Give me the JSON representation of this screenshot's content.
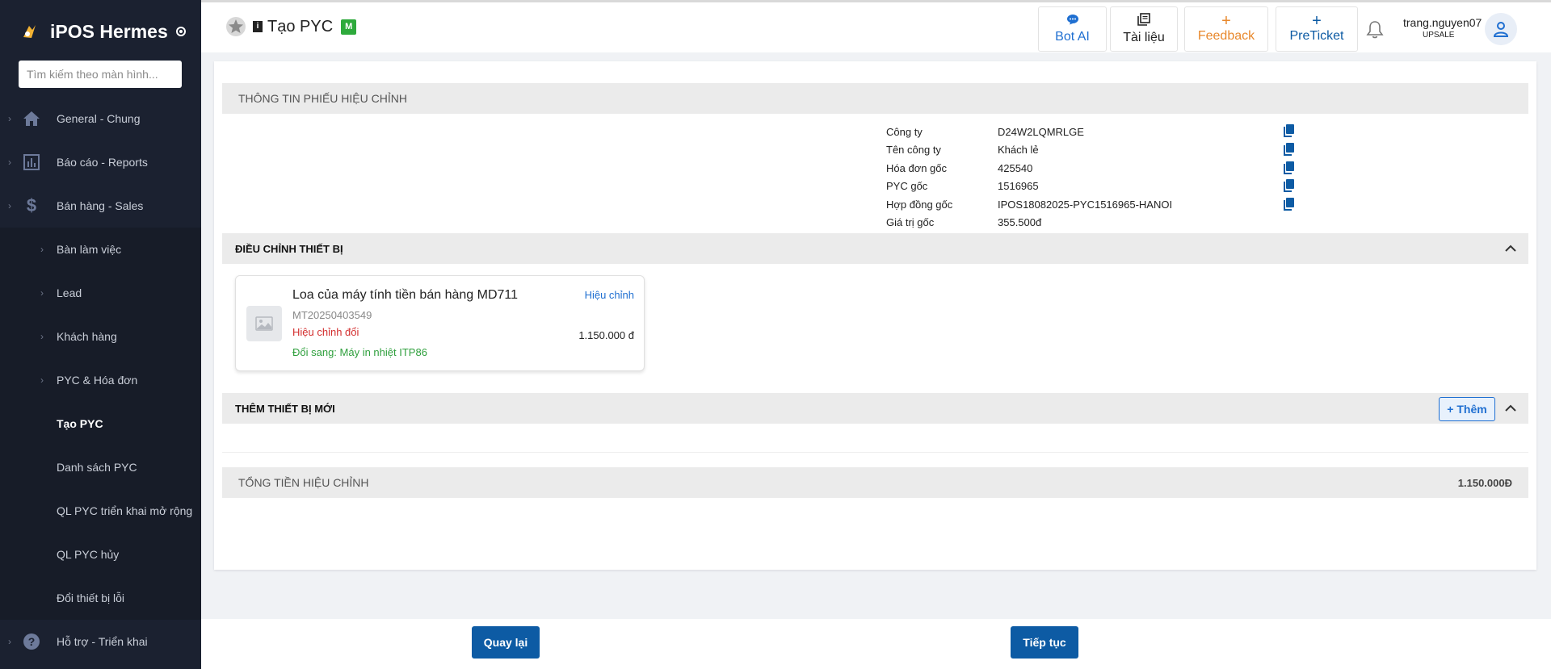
{
  "sidebar": {
    "brand": "iPOS Hermes",
    "search_placeholder": "Tìm kiếm theo màn hình...",
    "items": [
      {
        "label": "General - Chung",
        "icon": "home-icon"
      },
      {
        "label": "Báo cáo - Reports",
        "icon": "report-icon"
      },
      {
        "label": "Bán hàng - Sales",
        "icon": "dollar-icon"
      },
      {
        "label": "Bàn làm việc"
      },
      {
        "label": "Lead"
      },
      {
        "label": "Khách hàng"
      },
      {
        "label": "PYC & Hóa đơn"
      },
      {
        "label": "Tạo PYC"
      },
      {
        "label": "Danh sách PYC"
      },
      {
        "label": "QL PYC triển khai mở rộng"
      },
      {
        "label": "QL PYC hủy"
      },
      {
        "label": "Đổi thiết bị lỗi"
      },
      {
        "label": "Hỗ trợ - Triển khai",
        "icon": "help-icon"
      }
    ]
  },
  "header": {
    "title": "Tạo PYC",
    "badge": "M",
    "buttons": {
      "bot_ai": "Bot AI",
      "docs": "Tài liệu",
      "feedback": "Feedback",
      "preticket": "PreTicket"
    },
    "user": {
      "name": "trang.nguyen07",
      "role": "UPSALE"
    }
  },
  "info_section": {
    "title": "THÔNG TIN PHIẾU HIỆU CHỈNH",
    "rows": [
      {
        "label": "Công ty",
        "value": "D24W2LQMRLGE"
      },
      {
        "label": "Tên công ty",
        "value": "Khách lẻ"
      },
      {
        "label": "Hóa đơn gốc",
        "value": "425540"
      },
      {
        "label": "PYC gốc",
        "value": "1516965"
      },
      {
        "label": "Hợp đồng gốc",
        "value": "IPOS18082025-PYC1516965-HANOI"
      },
      {
        "label": "Giá trị gốc",
        "value": "355.500đ"
      }
    ]
  },
  "device_section": {
    "title": "ĐIỀU CHỈNH THIẾT BỊ",
    "item": {
      "name": "Loa của máy tính tiền bán hàng MD711",
      "code": "MT20250403549",
      "status": "Hiệu chỉnh đổi",
      "swap": "Đổi sang: Máy in nhiệt ITP86",
      "edit_label": "Hiệu chỉnh",
      "price": "1.150.000 đ"
    }
  },
  "new_section": {
    "title": "THÊM THIẾT BỊ MỚI",
    "add_label": "+ Thêm"
  },
  "total_section": {
    "title": "TỔNG TIỀN HIỆU CHỈNH",
    "value": "1.150.000Đ"
  },
  "footer": {
    "back_label": "Quay lại",
    "next_label": "Tiếp tục"
  },
  "colors": {
    "sidebar_bg": "#1b2130",
    "primary": "#0d5ba4",
    "feedback": "#e8882c",
    "link": "#1f6fd1",
    "danger": "#d32f2f",
    "success": "#2e9f3c"
  }
}
